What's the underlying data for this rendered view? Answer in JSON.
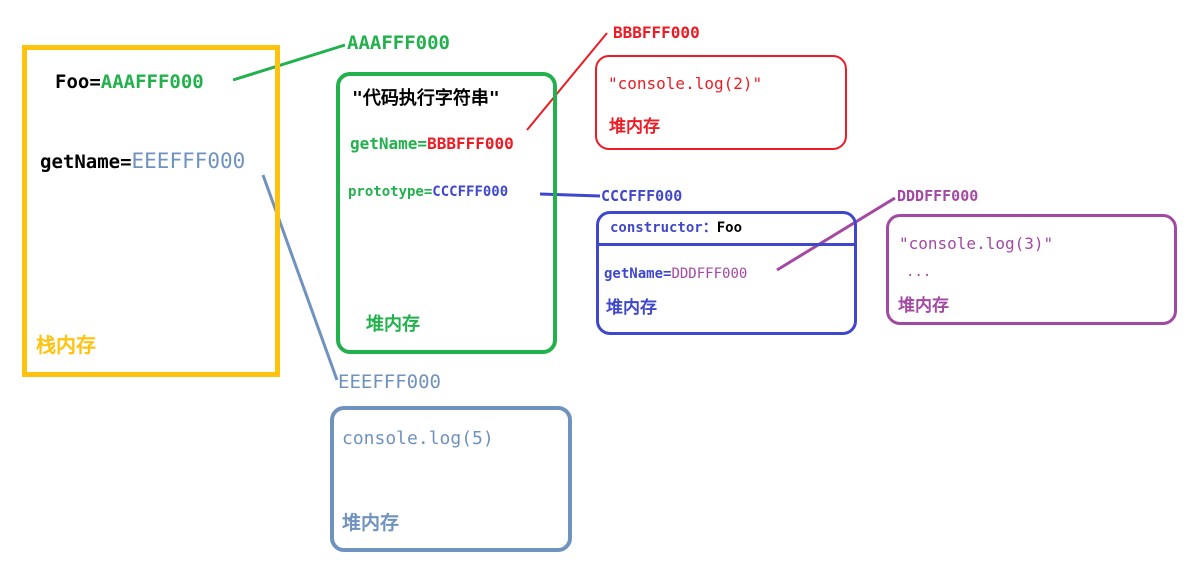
{
  "colors": {
    "stack": "#FFC20E",
    "green": "#22B14C",
    "red": "#ED1C24",
    "blue": "#3F48CC",
    "purple": "#A349A4",
    "steel": "#7092BE",
    "black": "#000000"
  },
  "stack": {
    "foo_label": "Foo=",
    "foo_value": "AAAFFF000",
    "getname_label": "getName=",
    "getname_value": "EEEFFF000",
    "title": "栈内存"
  },
  "foo_heap": {
    "address": "AAAFFF000",
    "code": "\"代码执行字符串\"",
    "getname_label": "getName=",
    "getname_value": "BBBFFF000",
    "prototype_label": "prototype=",
    "prototype_value": "CCCFFF000",
    "title": "堆内存"
  },
  "bbb_heap": {
    "address": "BBBFFF000",
    "code": "\"console.log(2)\"",
    "title": "堆内存"
  },
  "ccc_heap": {
    "address": "CCCFFF000",
    "constructor_label": "constructor：",
    "constructor_value": "Foo",
    "getname_label": "getName=",
    "getname_value": "DDDFFF000",
    "title": "堆内存"
  },
  "ddd_heap": {
    "address": "DDDFFF000",
    "code": "\"console.log(3)\"",
    "ellipsis": "...",
    "title": "堆内存"
  },
  "eee_heap": {
    "address": "EEEFFF000",
    "code": "console.log(5)",
    "title": "堆内存"
  }
}
